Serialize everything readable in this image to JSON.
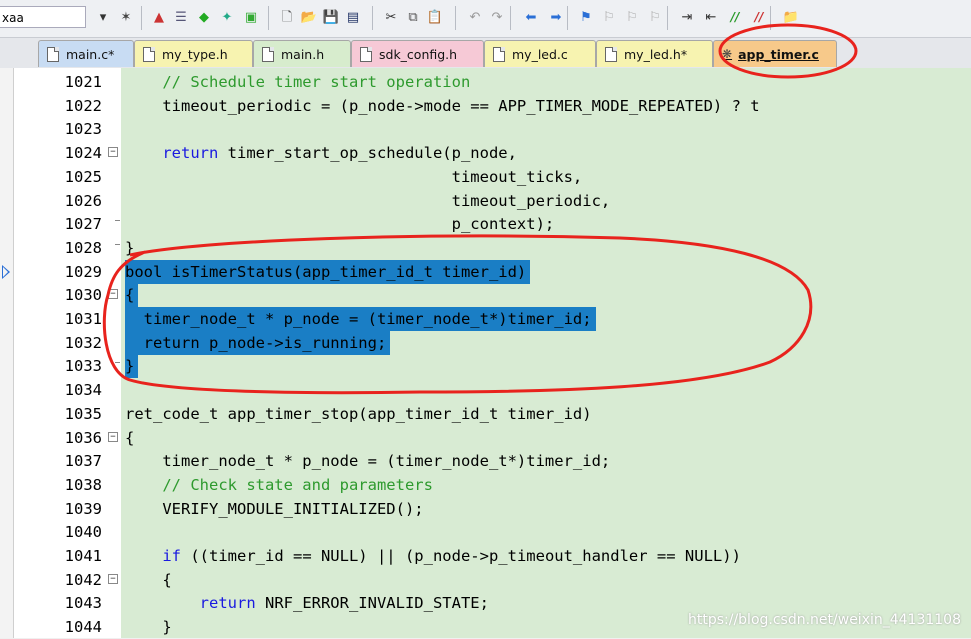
{
  "toolbar": {
    "input_value": "xaa",
    "buttons": [
      {
        "name": "dropdown-icon",
        "glyph": "▾",
        "color": "#333"
      },
      {
        "name": "wizard-icon",
        "glyph": "✶",
        "color": "#444"
      },
      {
        "name": "build-icon",
        "glyph": "▲",
        "color": "#c33"
      },
      {
        "name": "target-icon",
        "glyph": "☰",
        "color": "#557"
      },
      {
        "name": "diamond-icon",
        "glyph": "◆",
        "color": "#2a2"
      },
      {
        "name": "options-icon",
        "glyph": "✦",
        "color": "#2a8"
      },
      {
        "name": "pack-icon",
        "glyph": "▣",
        "color": "#3a3"
      },
      {
        "name": "new-file-icon",
        "glyph": "🗋",
        "color": "#555"
      },
      {
        "name": "open-folder-icon",
        "glyph": "📂",
        "color": "#c90"
      },
      {
        "name": "save-icon",
        "glyph": "💾",
        "color": "#236"
      },
      {
        "name": "save-all-icon",
        "glyph": "▤",
        "color": "#236"
      },
      {
        "name": "cut-icon",
        "glyph": "✂",
        "color": "#333"
      },
      {
        "name": "copy-icon",
        "glyph": "⧉",
        "color": "#555"
      },
      {
        "name": "paste-icon",
        "glyph": "📋",
        "color": "#a70"
      },
      {
        "name": "undo-icon",
        "glyph": "↶",
        "color": "#999"
      },
      {
        "name": "redo-icon",
        "glyph": "↷",
        "color": "#999"
      },
      {
        "name": "back-icon",
        "glyph": "⬅",
        "color": "#2a6fd6"
      },
      {
        "name": "forward-icon",
        "glyph": "➡",
        "color": "#2a6fd6"
      },
      {
        "name": "bookmark-icon",
        "glyph": "⚑",
        "color": "#2a6fd6"
      },
      {
        "name": "bookmark-prev-icon",
        "glyph": "⚐",
        "color": "#aaa"
      },
      {
        "name": "bookmark-next-icon",
        "glyph": "⚐",
        "color": "#aaa"
      },
      {
        "name": "bookmark-clear-icon",
        "glyph": "⚐",
        "color": "#aaa"
      },
      {
        "name": "indent-icon",
        "glyph": "⇥",
        "color": "#333"
      },
      {
        "name": "unindent-icon",
        "glyph": "⇤",
        "color": "#333"
      },
      {
        "name": "comment-icon",
        "glyph": "//",
        "color": "#2a9a2a"
      },
      {
        "name": "uncomment-icon",
        "glyph": "//",
        "color": "#c33"
      },
      {
        "name": "find-in-files-icon",
        "glyph": "📁",
        "color": "#a70"
      }
    ]
  },
  "tabs": [
    {
      "label": "main.c*",
      "color": "#c8dcf3",
      "active": false
    },
    {
      "label": "my_type.h",
      "color": "#f7f3b0",
      "active": false
    },
    {
      "label": "main.h",
      "color": "#d7eccd",
      "active": false
    },
    {
      "label": "sdk_config.h",
      "color": "#f6c9d6",
      "active": false
    },
    {
      "label": "my_led.c",
      "color": "#f7f3b0",
      "active": false
    },
    {
      "label": "my_led.h*",
      "color": "#f7f3b0",
      "active": false
    },
    {
      "label": "app_timer.c",
      "color": "#f7c98a",
      "active": true
    }
  ],
  "editor": {
    "current_line_marker": "1029",
    "lines": [
      {
        "num": "1021",
        "parts": [
          {
            "t": "    ",
            "c": ""
          },
          {
            "t": "// Schedule timer start operation",
            "c": "cm"
          }
        ]
      },
      {
        "num": "1022",
        "parts": [
          {
            "t": "    timeout_periodic = (p_node->mode == APP_TIMER_MODE_REPEATED) ? t",
            "c": ""
          }
        ]
      },
      {
        "num": "1023",
        "parts": [
          {
            "t": "",
            "c": ""
          }
        ]
      },
      {
        "num": "1024",
        "fold": "open",
        "parts": [
          {
            "t": "    ",
            "c": ""
          },
          {
            "t": "return",
            "c": "kw"
          },
          {
            "t": " timer_start_op_schedule(p_node,",
            "c": ""
          }
        ]
      },
      {
        "num": "1025",
        "parts": [
          {
            "t": "                                   timeout_ticks,",
            "c": ""
          }
        ]
      },
      {
        "num": "1026",
        "parts": [
          {
            "t": "                                   timeout_periodic,",
            "c": ""
          }
        ]
      },
      {
        "num": "1027",
        "fold": "end",
        "parts": [
          {
            "t": "                                   p_context);",
            "c": ""
          }
        ]
      },
      {
        "num": "1028",
        "fold": "end",
        "parts": [
          {
            "t": "}",
            "c": ""
          }
        ]
      },
      {
        "num": "1029",
        "sel": true,
        "parts": [
          {
            "t": "bool isTimerStatus(app_timer_id_t timer_id)",
            "c": ""
          }
        ]
      },
      {
        "num": "1030",
        "sel": true,
        "fold": "open",
        "parts": [
          {
            "t": "{",
            "c": ""
          }
        ]
      },
      {
        "num": "1031",
        "sel": true,
        "parts": [
          {
            "t": "  timer_node_t * p_node = (timer_node_t*)timer_id;",
            "c": ""
          }
        ]
      },
      {
        "num": "1032",
        "sel": true,
        "parts": [
          {
            "t": "  return p_node->is_running;",
            "c": ""
          }
        ]
      },
      {
        "num": "1033",
        "sel": true,
        "fold": "end",
        "parts": [
          {
            "t": "}",
            "c": ""
          }
        ]
      },
      {
        "num": "1034",
        "parts": [
          {
            "t": "",
            "c": ""
          }
        ]
      },
      {
        "num": "1035",
        "parts": [
          {
            "t": "ret_code_t app_timer_stop(app_timer_id_t timer_id)",
            "c": ""
          }
        ]
      },
      {
        "num": "1036",
        "fold": "open",
        "parts": [
          {
            "t": "{",
            "c": ""
          }
        ]
      },
      {
        "num": "1037",
        "parts": [
          {
            "t": "    timer_node_t * p_node = (timer_node_t*)timer_id;",
            "c": ""
          }
        ]
      },
      {
        "num": "1038",
        "parts": [
          {
            "t": "    ",
            "c": ""
          },
          {
            "t": "// Check state and parameters",
            "c": "cm"
          }
        ]
      },
      {
        "num": "1039",
        "parts": [
          {
            "t": "    VERIFY_MODULE_INITIALIZED();",
            "c": ""
          }
        ]
      },
      {
        "num": "1040",
        "parts": [
          {
            "t": "",
            "c": ""
          }
        ]
      },
      {
        "num": "1041",
        "parts": [
          {
            "t": "    ",
            "c": ""
          },
          {
            "t": "if",
            "c": "kw"
          },
          {
            "t": " ((timer_id == NULL) || (p_node->p_timeout_handler == NULL))",
            "c": ""
          }
        ]
      },
      {
        "num": "1042",
        "fold": "open",
        "parts": [
          {
            "t": "    {",
            "c": ""
          }
        ]
      },
      {
        "num": "1043",
        "parts": [
          {
            "t": "        ",
            "c": ""
          },
          {
            "t": "return",
            "c": "kw"
          },
          {
            "t": " NRF_ERROR_INVALID_STATE;",
            "c": ""
          }
        ]
      },
      {
        "num": "1044",
        "parts": [
          {
            "t": "    }",
            "c": ""
          }
        ]
      }
    ]
  },
  "watermark": "https://blog.csdn.net/weixin_44131108",
  "annotation_color": "#e8231d"
}
